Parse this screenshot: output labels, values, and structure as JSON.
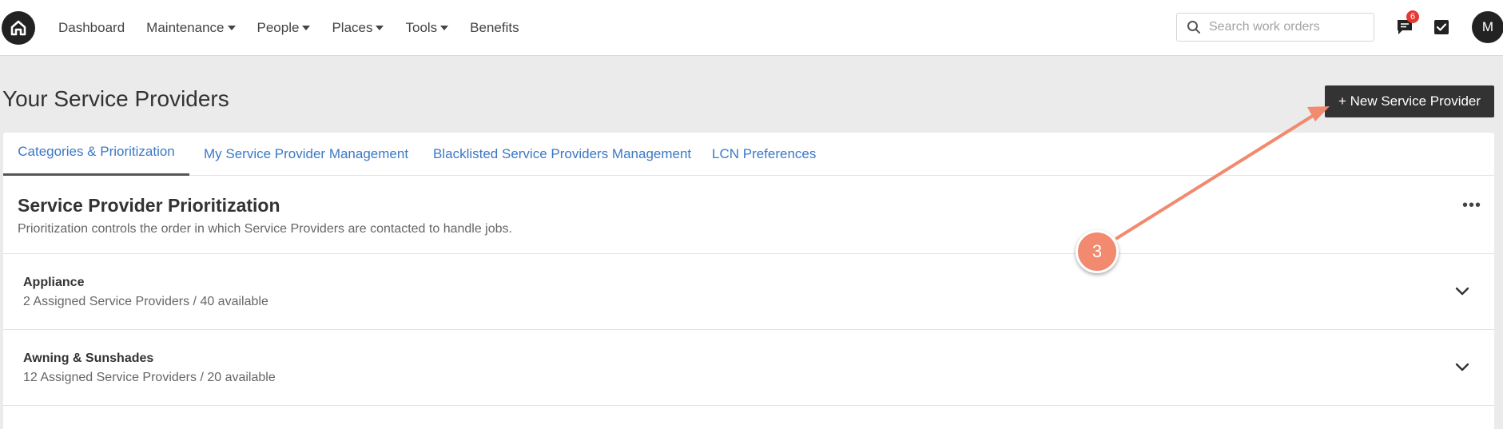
{
  "nav": {
    "links": [
      {
        "label": "Dashboard"
      },
      {
        "label": "Maintenance"
      },
      {
        "label": "People"
      },
      {
        "label": "Places"
      },
      {
        "label": "Tools"
      },
      {
        "label": "Benefits"
      }
    ],
    "search_placeholder": "Search work orders",
    "message_badge_count": "6",
    "avatar_initial": "M",
    "icons": [
      "home-logo-icon",
      "search-icon",
      "chat-icon",
      "checkbox-icon",
      "caret-down-icon"
    ]
  },
  "page": {
    "title": "Your Service Providers",
    "new_button_label": "+ New Service Provider"
  },
  "tabs": [
    {
      "label": "Categories & Prioritization",
      "active": true
    },
    {
      "label": "My Service Provider Management",
      "active": false
    },
    {
      "label": "Blacklisted Service Providers Management",
      "active": false
    },
    {
      "label": "LCN Preferences",
      "active": false
    }
  ],
  "section": {
    "title": "Service Provider Prioritization",
    "description": "Prioritization controls the order in which Service Providers are contacted to handle jobs."
  },
  "categories": [
    {
      "name": "Appliance",
      "summary": "2 Assigned Service Providers / 40 available"
    },
    {
      "name": "Awning & Sunshades",
      "summary": "12 Assigned Service Providers / 20 available"
    }
  ],
  "annotation": {
    "step_number": "3",
    "color": "#f18a6f"
  },
  "colors": {
    "link": "#3b78c6",
    "dark": "#333333",
    "badge": "#e53935",
    "background": "#ebebeb"
  }
}
